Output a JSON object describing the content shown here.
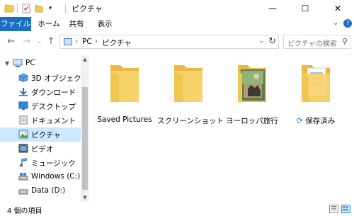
{
  "window": {
    "title": "ピクチャ",
    "minimize": "—",
    "maximize": "☐",
    "close": "✕"
  },
  "ribbon": {
    "tabs": [
      "ファイル",
      "ホーム",
      "共有",
      "表示"
    ],
    "expand_icon": "chevron-down-icon",
    "help_icon": "help-icon"
  },
  "address": {
    "crumbs": [
      "PC",
      "ピクチャ"
    ],
    "search_placeholder": "ピクチャの検索"
  },
  "nav": {
    "items": [
      {
        "label": "PC",
        "icon": "pc-icon"
      },
      {
        "label": "3D オブジェクト",
        "icon": "3d-objects-icon"
      },
      {
        "label": "ダウンロード",
        "icon": "download-icon"
      },
      {
        "label": "デスクトップ",
        "icon": "desktop-icon"
      },
      {
        "label": "ドキュメント",
        "icon": "documents-icon"
      },
      {
        "label": "ピクチャ",
        "icon": "pictures-icon"
      },
      {
        "label": "ビデオ",
        "icon": "videos-icon"
      },
      {
        "label": "ミュージック",
        "icon": "music-icon"
      },
      {
        "label": "Windows (C:)",
        "icon": "drive-icon"
      },
      {
        "label": "Data (D:)",
        "icon": "drive-icon"
      }
    ]
  },
  "content": {
    "items": [
      {
        "name": "Saved Pictures",
        "kind": "folder"
      },
      {
        "name": "スクリーンショット",
        "kind": "folder"
      },
      {
        "name": "ヨーロッパ旅行",
        "kind": "photo-folder"
      },
      {
        "name": "保存済み",
        "kind": "sync-folder"
      }
    ]
  },
  "status": {
    "count": "4 個の項目"
  },
  "colors": {
    "accent": "#1a6fc2",
    "selection": "#cce8ff",
    "folder": "#f5c851"
  }
}
